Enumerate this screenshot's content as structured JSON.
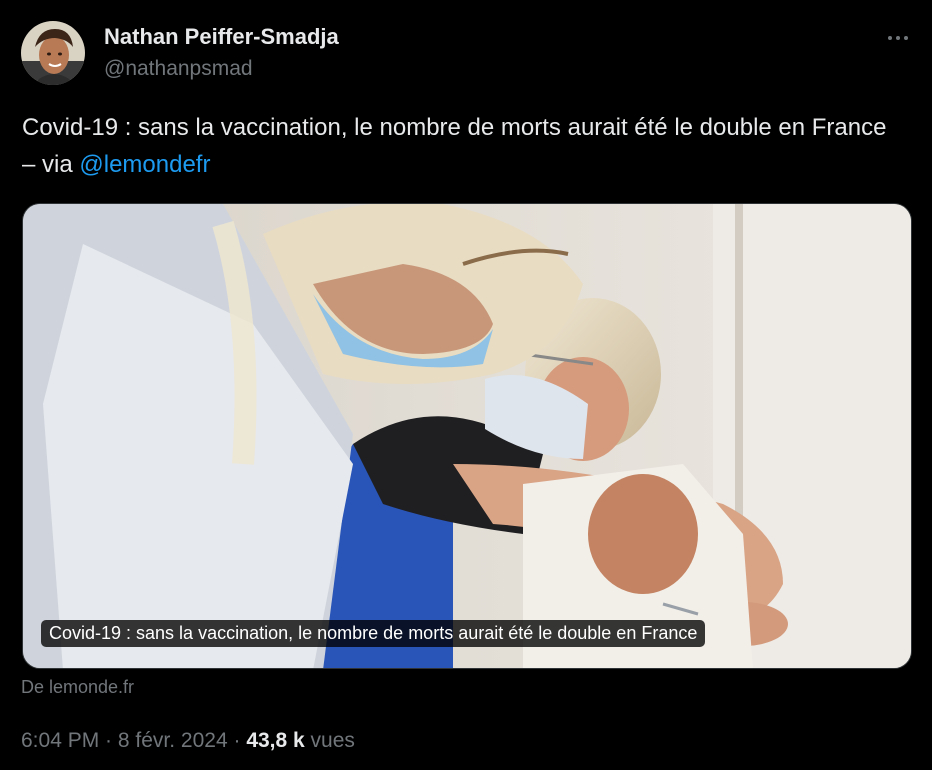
{
  "author": {
    "display_name": "Nathan Peiffer-Smadja",
    "handle": "@nathanpsmad"
  },
  "tweet": {
    "text_main": "Covid-19 : sans la vaccination, le nombre de morts aurait été le double en France – via ",
    "mention": "@lemondefr"
  },
  "card": {
    "caption": "Covid-19 : sans la vaccination, le nombre de morts aurait été le double en France",
    "source": "De lemonde.fr"
  },
  "meta": {
    "time": "6:04 PM",
    "separator1": " · ",
    "date": "8 févr. 2024",
    "separator2": " · ",
    "views_count": "43,8 k",
    "views_label": " vues"
  },
  "icons": {
    "more": "more-horizontal-icon"
  },
  "colors": {
    "background": "#000000",
    "text": "#e7e9ea",
    "secondary": "#71767b",
    "link": "#1d9bf0"
  }
}
